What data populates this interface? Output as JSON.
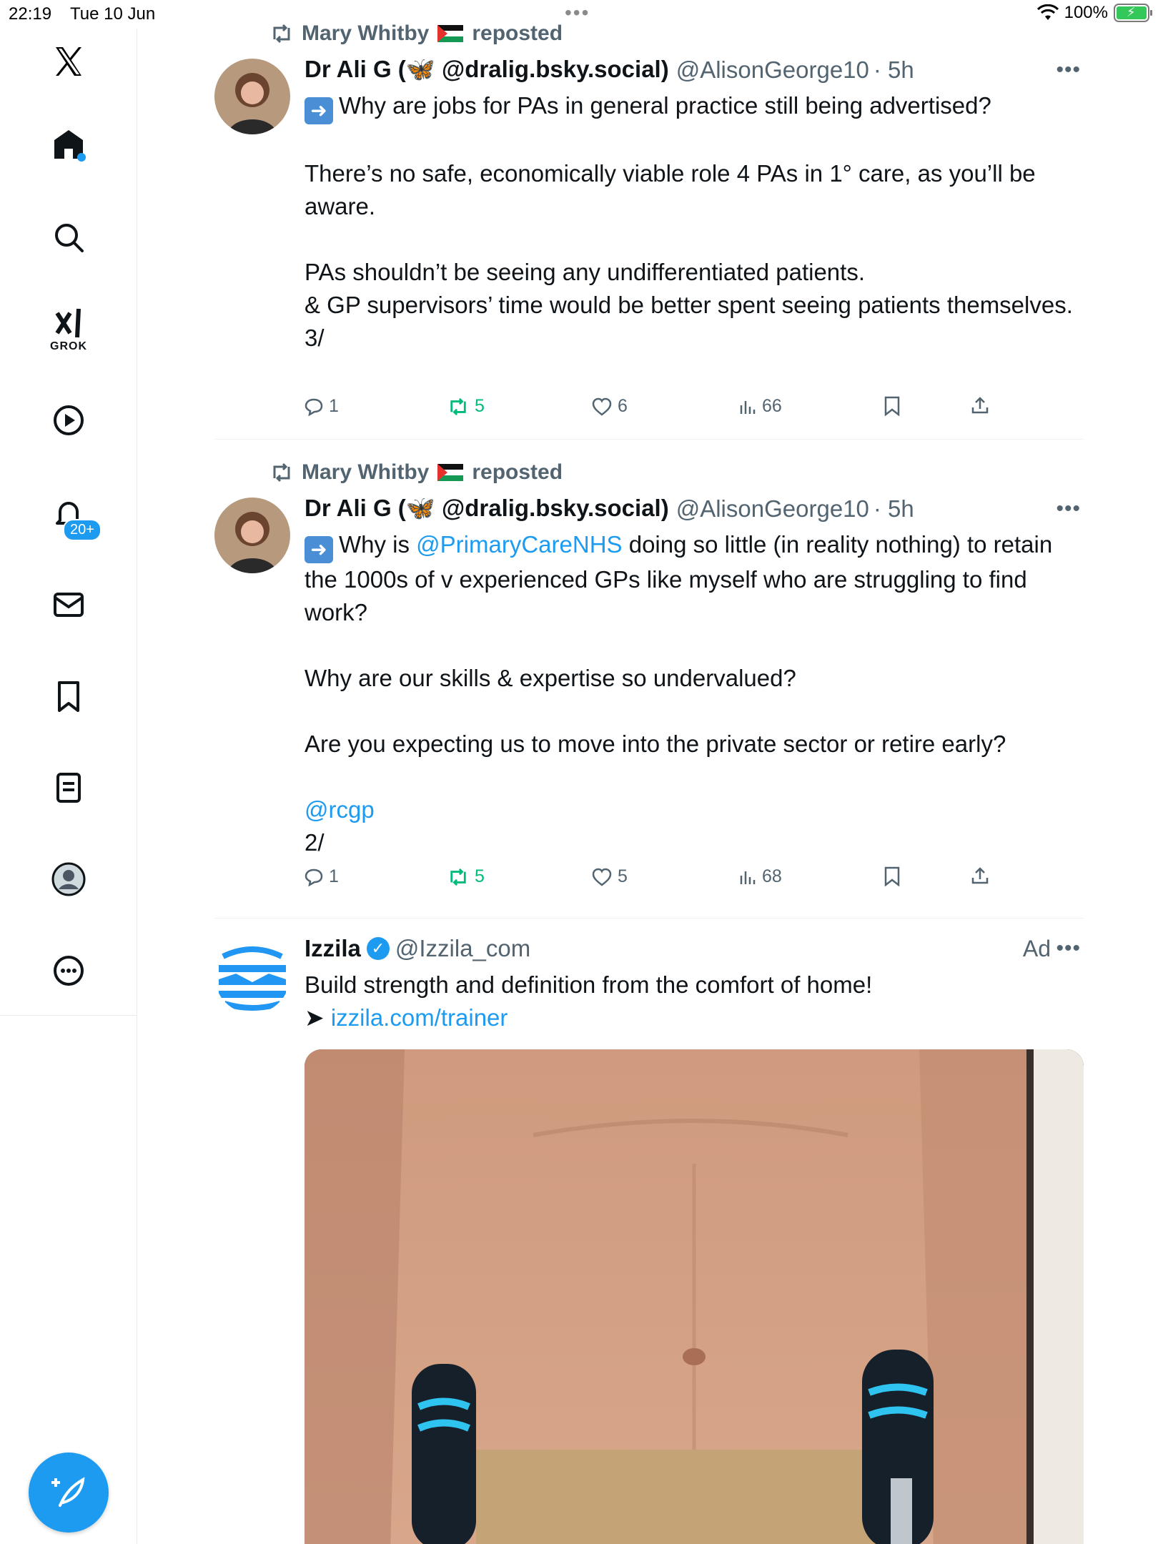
{
  "status_bar": {
    "time": "22:19",
    "date": "Tue 10 Jun",
    "battery": "100%"
  },
  "sidebar": {
    "grok_label": "GROK",
    "notifications_badge": "20+"
  },
  "posts": [
    {
      "repost_by": "Mary Whitby",
      "repost_label": "reposted",
      "author_name": "Dr Ali G (",
      "author_name_tail": " @dralig.bsky.social)",
      "author_handle": "@AlisonGeorge10",
      "time": "· 5h",
      "text": "Why are jobs for PAs in general practice still being advertised?\n\nThere’s no safe, economically viable role 4 PAs in 1° care, as you’ll be aware.\n\nPAs shouldn’t be seeing any undifferentiated patients.\n& GP supervisors’ time would be better spent seeing patients themselves.\n3/",
      "replies": "1",
      "reposts": "5",
      "likes": "6",
      "views": "66"
    },
    {
      "repost_by": "Mary Whitby",
      "repost_label": "reposted",
      "author_name": "Dr Ali G (",
      "author_name_tail": " @dralig.bsky.social)",
      "author_handle": "@AlisonGeorge10",
      "time": "· 5h",
      "text_1": "Why is ",
      "mention": "@PrimaryCareNHS",
      "text_2": " doing so little (in reality nothing) to retain the 1000s of v experienced GPs like myself who are struggling to find work?\n\nWhy are our skills & expertise so undervalued?\n\nAre you expecting us to move into the private sector or retire early?\n\n",
      "mention_2": "@rcgp",
      "text_3": "\n2/",
      "replies": "1",
      "reposts": "5",
      "likes": "5",
      "views": "68"
    },
    {
      "author_name": "Izzila",
      "author_handle": "@Izzila_com",
      "ad_label": "Ad",
      "text": "Build strength and definition from the comfort of home!",
      "arrow": "➤ ",
      "link": "izzila.com/trainer"
    }
  ],
  "colors": {
    "accent": "#1d9bf0",
    "repost_green": "#00ba7c",
    "muted": "#536471"
  }
}
